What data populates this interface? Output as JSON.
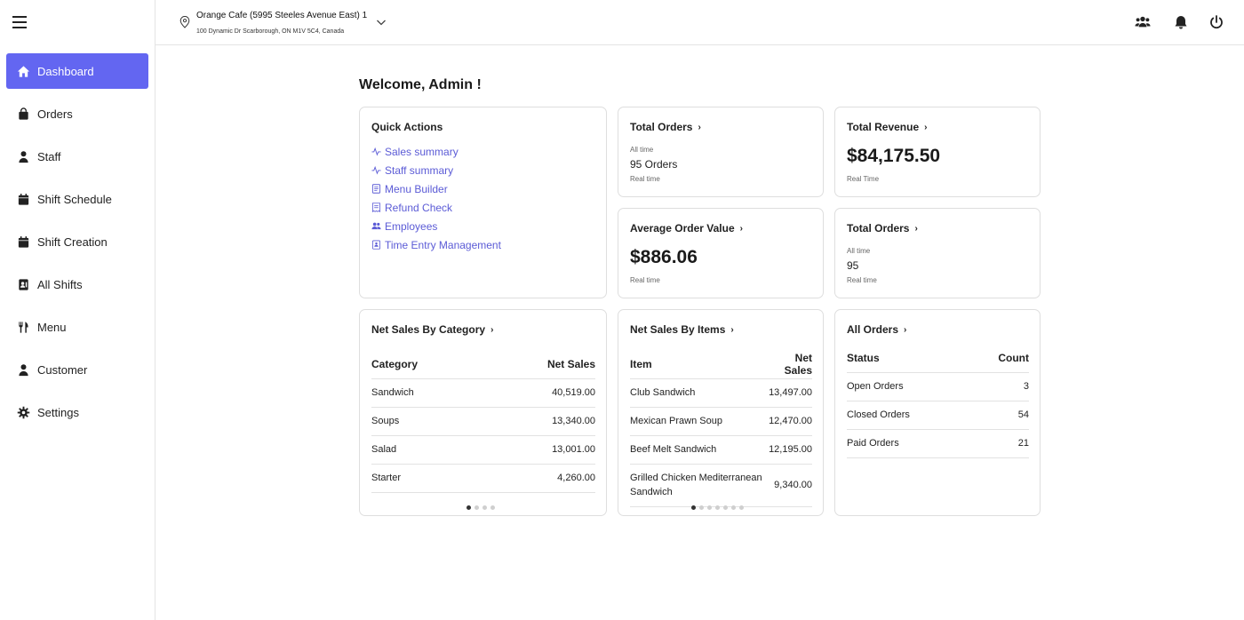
{
  "location": {
    "title": "Orange Cafe (5995 Steeles Avenue East) 1",
    "address": "100 Dynamic Dr Scarborough, ON M1V 5C4, Canada"
  },
  "nav": {
    "items": [
      {
        "label": "Dashboard",
        "icon": "home-icon"
      },
      {
        "label": "Orders",
        "icon": "bag-icon"
      },
      {
        "label": "Staff",
        "icon": "user-icon"
      },
      {
        "label": "Shift Schedule",
        "icon": "calendar-icon"
      },
      {
        "label": "Shift Creation",
        "icon": "calendar-icon"
      },
      {
        "label": "All Shifts",
        "icon": "id-card-icon"
      },
      {
        "label": "Menu",
        "icon": "utensils-icon"
      },
      {
        "label": "Customer",
        "icon": "user-icon"
      },
      {
        "label": "Settings",
        "icon": "gear-icon"
      }
    ]
  },
  "welcome": "Welcome, Admin !",
  "quick_actions": {
    "title": "Quick Actions",
    "items": [
      {
        "label": "Sales summary",
        "icon": "pulse-icon"
      },
      {
        "label": "Staff summary",
        "icon": "pulse-icon"
      },
      {
        "label": "Menu Builder",
        "icon": "menu-book-icon"
      },
      {
        "label": "Refund Check",
        "icon": "receipt-icon"
      },
      {
        "label": "Employees",
        "icon": "users-icon"
      },
      {
        "label": "Time Entry Management",
        "icon": "clipboard-icon"
      }
    ]
  },
  "total_orders_1": {
    "title": "Total Orders",
    "period": "All time",
    "value": "95 Orders",
    "note": "Real time"
  },
  "total_revenue": {
    "title": "Total Revenue",
    "value": "$84,175.50",
    "note": "Real Time"
  },
  "avg_order": {
    "title": "Average Order Value",
    "value": "$886.06",
    "note": "Real time"
  },
  "total_orders_2": {
    "title": "Total Orders",
    "period": "All time",
    "value": "95",
    "note": "Real time"
  },
  "by_category": {
    "title": "Net Sales By Category",
    "headers": [
      "Category",
      "Net Sales"
    ],
    "rows": [
      [
        "Sandwich",
        "40,519.00"
      ],
      [
        "Soups",
        "13,340.00"
      ],
      [
        "Salad",
        "13,001.00"
      ],
      [
        "Starter",
        "4,260.00"
      ]
    ]
  },
  "by_items": {
    "title": "Net Sales By Items",
    "headers": [
      "Item",
      "Net Sales"
    ],
    "rows": [
      [
        "Club Sandwich",
        "13,497.00"
      ],
      [
        "Mexican Prawn Soup",
        "12,470.00"
      ],
      [
        "Beef Melt Sandwich",
        "12,195.00"
      ],
      [
        "Grilled Chicken Mediterranean Sandwich",
        "9,340.00"
      ]
    ]
  },
  "all_orders": {
    "title": "All Orders",
    "headers": [
      "Status",
      "Count"
    ],
    "rows": [
      [
        "Open Orders",
        "3"
      ],
      [
        "Closed Orders",
        "54"
      ],
      [
        "Paid Orders",
        "21"
      ]
    ]
  },
  "colors": {
    "accent": "#6366f1",
    "link": "#5b5bd6"
  }
}
